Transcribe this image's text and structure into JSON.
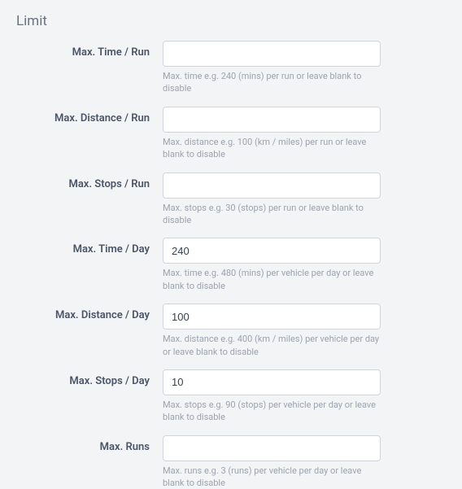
{
  "section": {
    "title": "Limit"
  },
  "fields": {
    "maxTimeRun": {
      "label": "Max. Time / Run",
      "value": "",
      "help": "Max. time e.g. 240 (mins) per run or leave blank to disable"
    },
    "maxDistanceRun": {
      "label": "Max. Distance / Run",
      "value": "",
      "help": "Max. distance e.g. 100 (km / miles) per run or leave blank to disable"
    },
    "maxStopsRun": {
      "label": "Max. Stops / Run",
      "value": "",
      "help": "Max. stops e.g. 30 (stops) per run or leave blank to disable"
    },
    "maxTimeDay": {
      "label": "Max. Time / Day",
      "value": "240",
      "help": "Max. time e.g. 480 (mins) per vehicle per day or leave blank to disable"
    },
    "maxDistanceDay": {
      "label": "Max. Distance / Day",
      "value": "100",
      "help": "Max. distance e.g. 400 (km / miles) per vehicle per day or leave blank to disable"
    },
    "maxStopsDay": {
      "label": "Max. Stops / Day",
      "value": "10",
      "help": "Max. stops e.g. 90 (stops) per vehicle per day or leave blank to disable"
    },
    "maxRuns": {
      "label": "Max. Runs",
      "value": "",
      "help": "Max. runs e.g. 3 (runs) per vehicle per day or leave blank to disable"
    }
  }
}
